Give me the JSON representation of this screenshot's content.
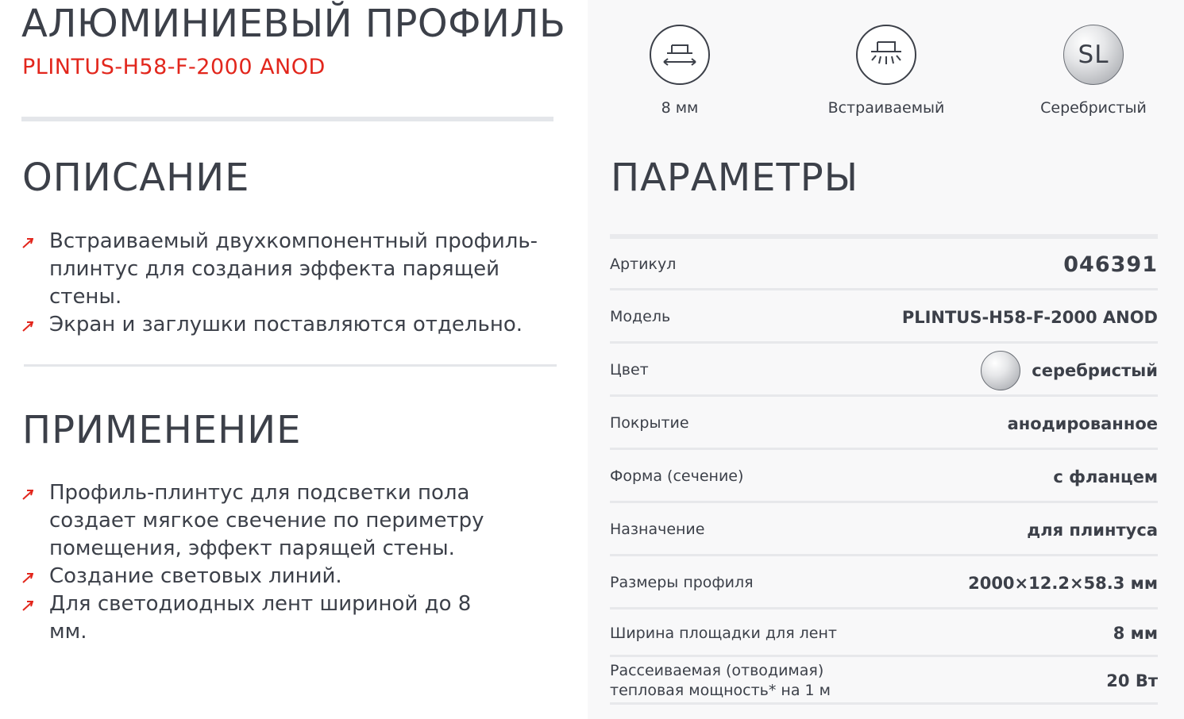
{
  "header": {
    "title": "АЛЮМИНИЕВЫЙ ПРОФИЛЬ",
    "model": "PLINTUS-H58-F-2000 ANOD"
  },
  "description": {
    "title": "ОПИСАНИЕ",
    "items": [
      "Встраиваемый двухкомпонентный профиль-плинтус для создания эффекта парящей стены.",
      "Экран и заглушки поставляются отдельно."
    ]
  },
  "application": {
    "title": "ПРИМЕНЕНИЕ",
    "items": [
      "Профиль-плинтус для подсветки пола создает мягкое свечение по периметру помещения, эффект парящей стены.",
      "Создание световых линий.",
      "Для светодиодных лент шириной до 8 мм."
    ]
  },
  "features": [
    {
      "icon": "tape-width-icon",
      "caption": "8 мм"
    },
    {
      "icon": "recessed-icon",
      "caption": "Встраиваемый"
    },
    {
      "icon": "silver-color-icon",
      "badge": "SL",
      "caption": "Серебристый"
    }
  ],
  "parameters": {
    "title": "ПАРАМЕТРЫ",
    "rows": [
      {
        "label": "Артикул",
        "value": "046391"
      },
      {
        "label": "Модель",
        "value": "PLINTUS-H58-F-2000 ANOD"
      },
      {
        "label": "Цвет",
        "value": "серебристый"
      },
      {
        "label": "Покрытие",
        "value": "анодированное"
      },
      {
        "label": "Форма (сечение)",
        "value": "с фланцем"
      },
      {
        "label": "Назначение",
        "value": "для плинтуса"
      },
      {
        "label": "Размеры профиля",
        "value": "2000×12.2×58.3 мм"
      },
      {
        "label": "Ширина площадки для лент",
        "value": "8 мм"
      },
      {
        "label_line1": "Рассеиваемая (отводимая)",
        "label_line2": "тепловая мощность* на 1 м",
        "value": "20 Вт"
      }
    ]
  },
  "colors": {
    "accent": "#e2261c",
    "text": "#3c4049",
    "panel": "#f8f8f9"
  }
}
